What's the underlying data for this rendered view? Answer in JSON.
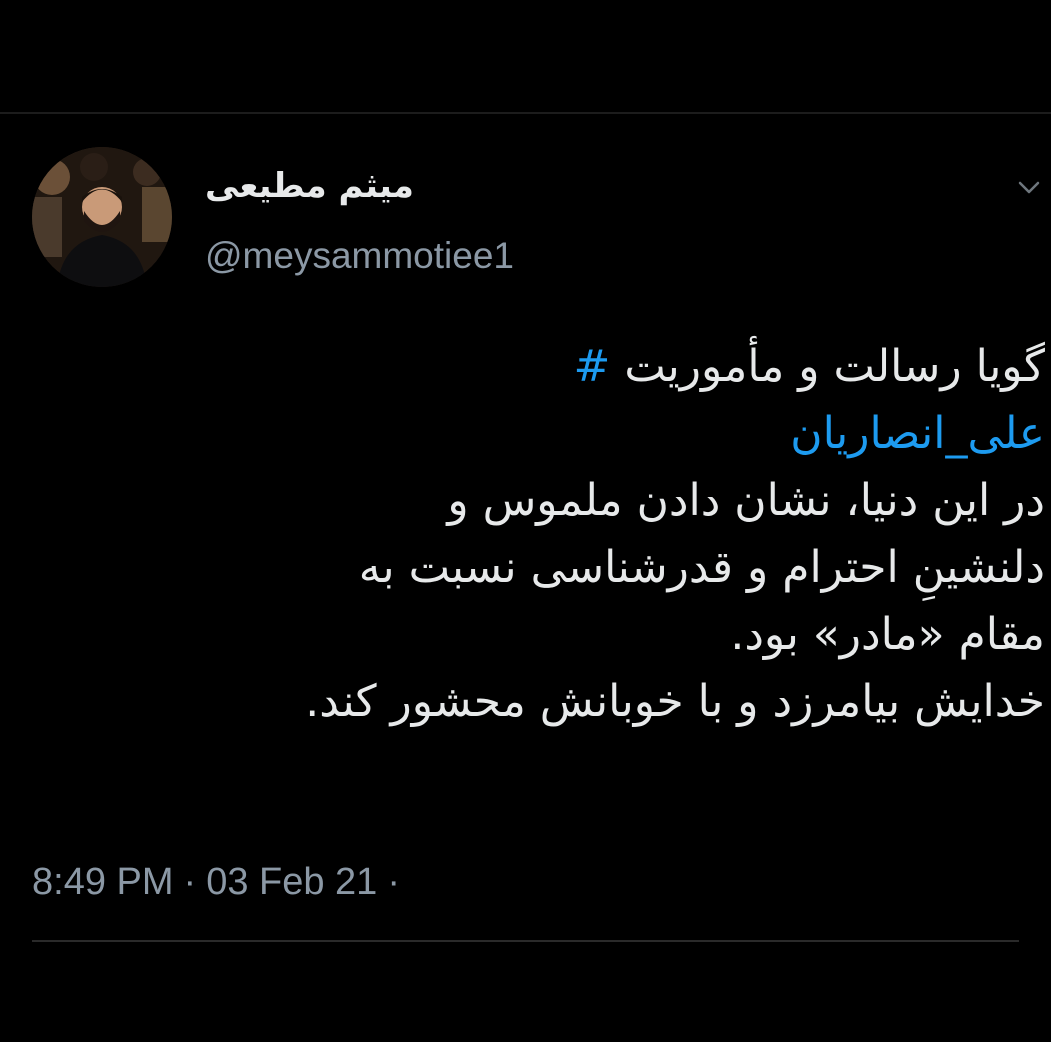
{
  "account": {
    "display_name": "میثم مطیعی",
    "handle": "@meysammotiee1"
  },
  "tweet": {
    "line1_prefix": "گویا رسالت و مأموریت",
    "line1_hashtag_head": "#",
    "line2_hashtag_rest": "علی_انصاریان",
    "line3": "در این دنیا، نشان دادن ملموس و",
    "line4": "دلنشینِ احترام و قدرشناسی نسبت به",
    "line5": "مقام «مادر» بود.",
    "line6": "خدایش بیامرزد و با خوبانش محشور کند."
  },
  "meta": {
    "time": "8:49 PM",
    "separator": "·",
    "date": "03 Feb 21",
    "trailing_separator": "·"
  },
  "icons": {
    "menu": "chevron-down-icon"
  },
  "colors": {
    "background": "#000000",
    "text": "#e7e9ea",
    "secondary": "#8b98a5",
    "hashtag": "#1d9bf0"
  }
}
